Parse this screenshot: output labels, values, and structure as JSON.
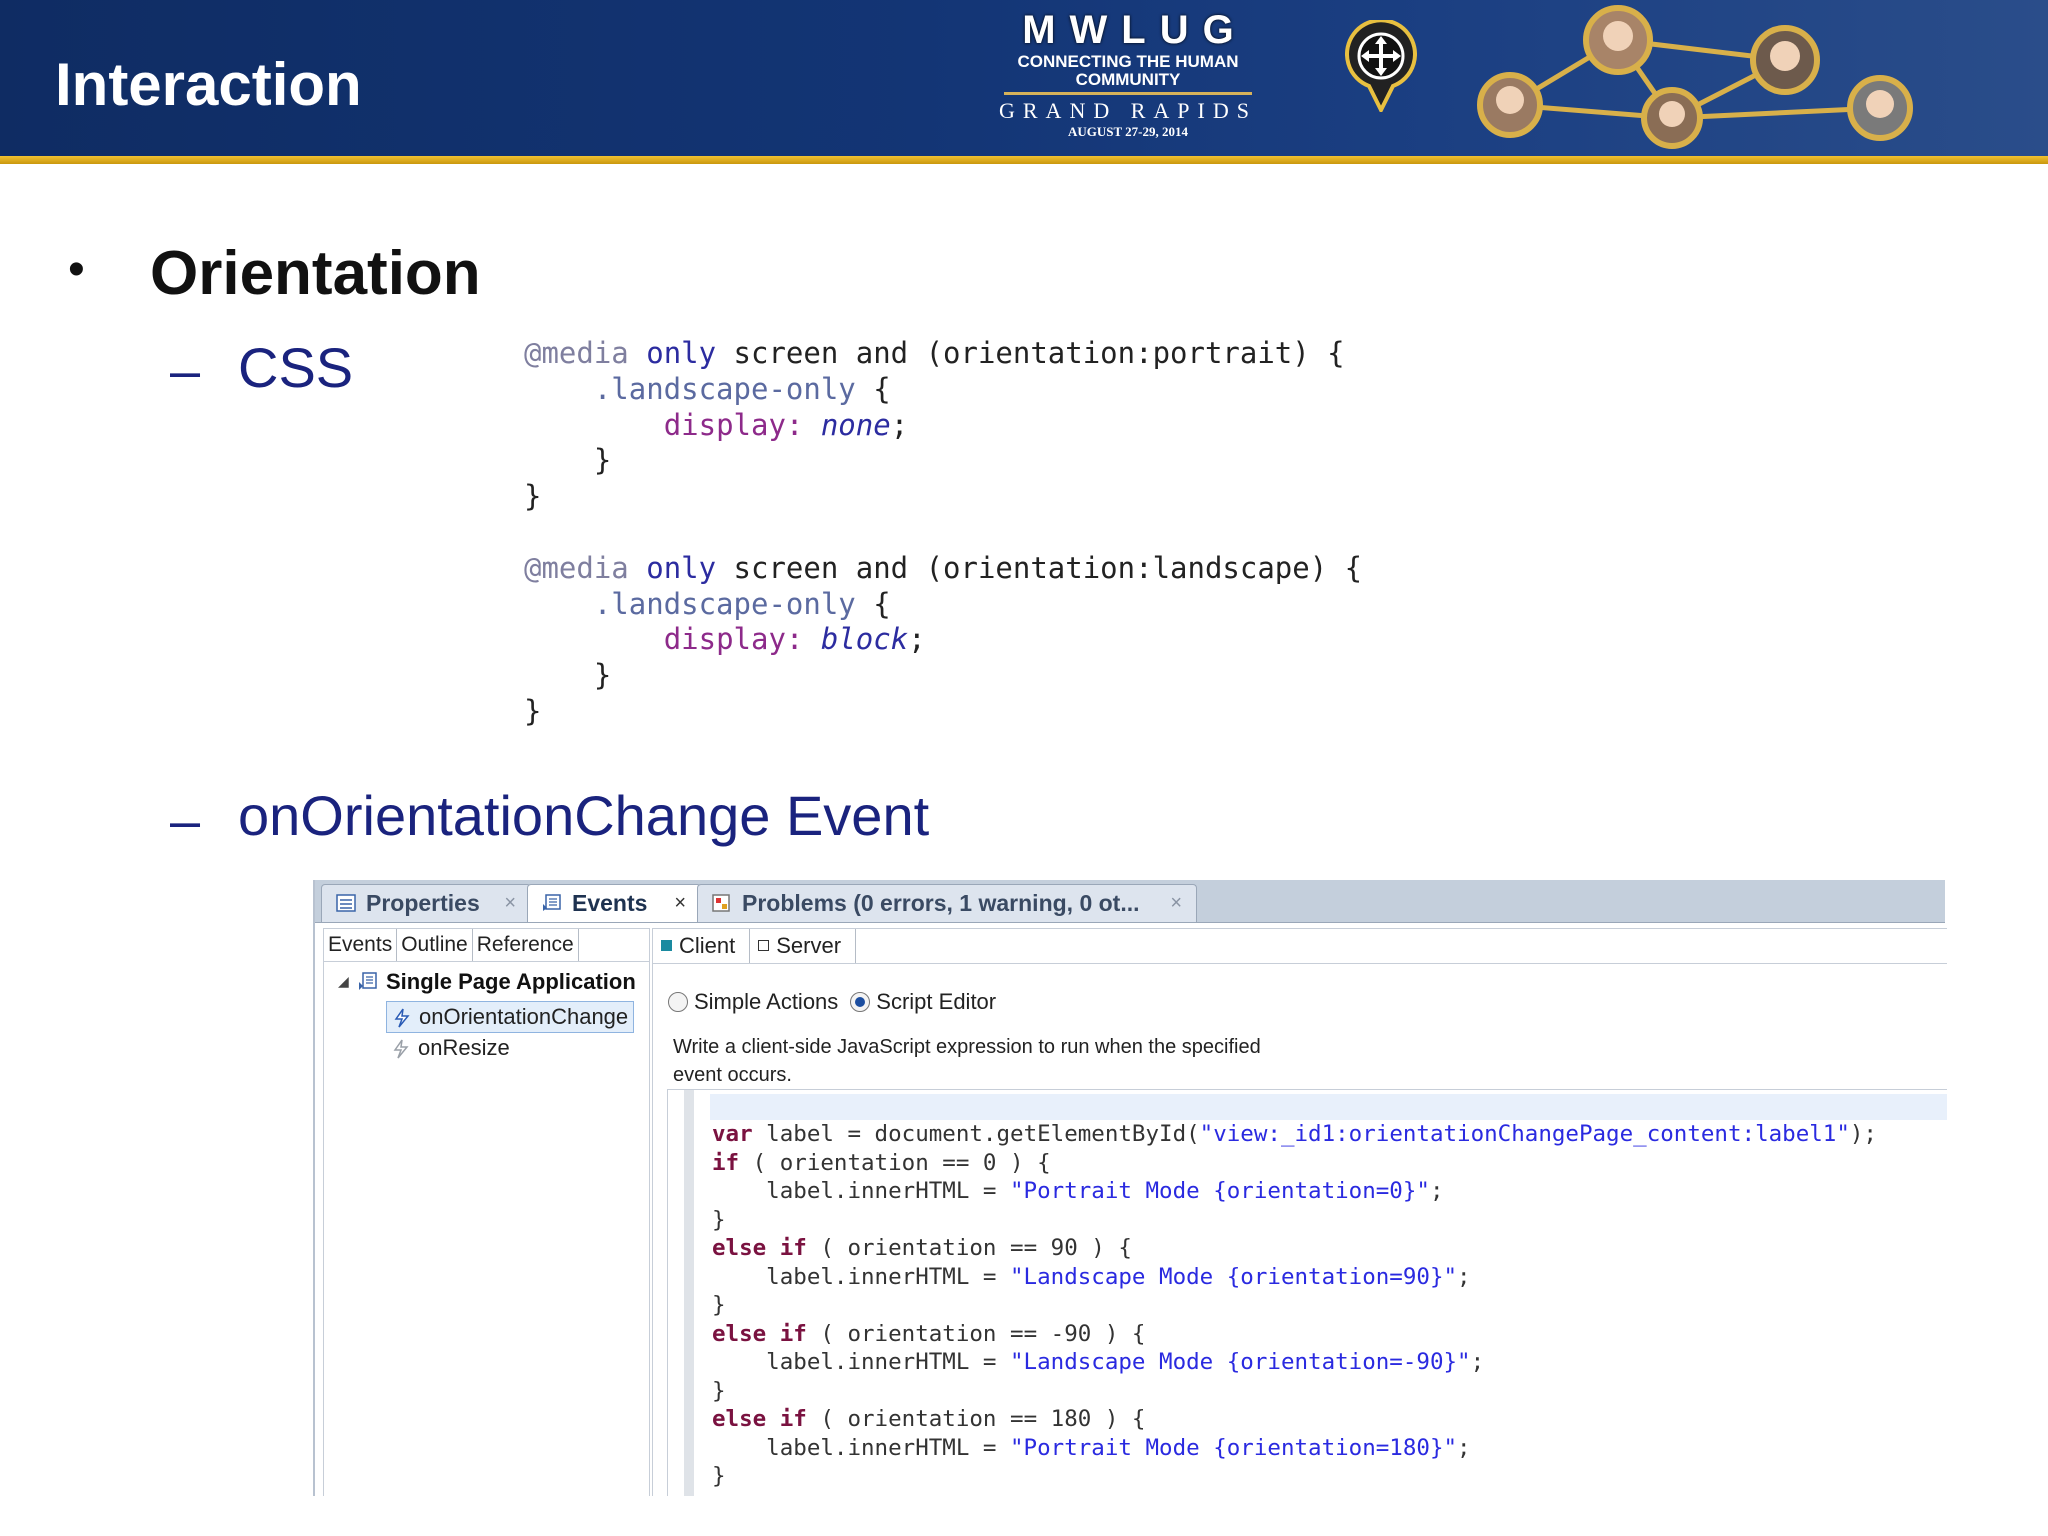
{
  "slide": {
    "title": "Interaction",
    "logo": {
      "name": "MWLUG",
      "tagline_1": "CONNECTING THE HUMAN",
      "tagline_2": "COMMUNITY",
      "city": "GRAND RAPIDS",
      "dates": "AUGUST 27-29, 2014"
    },
    "bullet": "Orientation",
    "sub1": "CSS",
    "sub2": "onOrientationChange Event"
  },
  "css_code": {
    "block1": {
      "at_media": "@media",
      "only": "only",
      "rest": " screen and (orientation:portrait) {",
      "selector": ".landscape-only",
      "brace_open": " {",
      "prop": "display:",
      "value": "none",
      "semi": ";",
      "inner_close": "}",
      "outer_close": "}"
    },
    "block2": {
      "at_media": "@media",
      "only": "only",
      "rest": " screen and (orientation:landscape) {",
      "selector": ".landscape-only",
      "brace_open": " {",
      "prop": "display:",
      "value": "block",
      "semi": ";",
      "inner_close": "}",
      "outer_close": "}"
    }
  },
  "ide": {
    "tabs": [
      {
        "label": "Properties",
        "close": "×"
      },
      {
        "label": "Events",
        "close": "×"
      },
      {
        "label": "Problems (0 errors, 1 warning, 0 ot...",
        "close": "×"
      }
    ],
    "left_tabs": [
      "Events",
      "Outline",
      "Reference"
    ],
    "tree": {
      "expand": "◢",
      "root": "Single Page Application",
      "items": [
        "onOrientationChange",
        "onResize"
      ]
    },
    "right_tabs": [
      "Client",
      "Server"
    ],
    "radio_options": [
      "Simple Actions",
      "Script Editor"
    ],
    "help_text": "Write a client-side JavaScript expression to run when the specified event occurs.",
    "script": {
      "l1_kw": "var",
      "l1_code": " label = document.getElementById(",
      "l1_str": "\"view:_id1:orientationChangePage_content:label1\"",
      "l1_end": ");",
      "l2_kw": "if",
      "l2_code": " ( orientation == 0 ) {",
      "l3_code": "    label.innerHTML = ",
      "l3_str": "\"Portrait Mode {orientation=0}\"",
      "l3_end": ";",
      "l4_code": "}",
      "l5_kw": "else if",
      "l5_code": " ( orientation == 90 ) {",
      "l6_code": "    label.innerHTML = ",
      "l6_str": "\"Landscape Mode {orientation=90}\"",
      "l6_end": ";",
      "l7_code": "}",
      "l8_kw": "else if",
      "l8_code": " ( orientation == -90 ) {",
      "l9_code": "    label.innerHTML = ",
      "l9_str": "\"Landscape Mode {orientation=-90}\"",
      "l9_end": ";",
      "l10_code": "}",
      "l11_kw": "else if",
      "l11_code": " ( orientation == 180 ) {",
      "l12_code": "    label.innerHTML = ",
      "l12_str": "\"Portrait Mode {orientation=180}\"",
      "l12_end": ";",
      "l13_code": "}"
    }
  },
  "colors": {
    "banner": "#133575",
    "accent_gold": "#f2c230",
    "subheading_blue": "#1a237e"
  }
}
